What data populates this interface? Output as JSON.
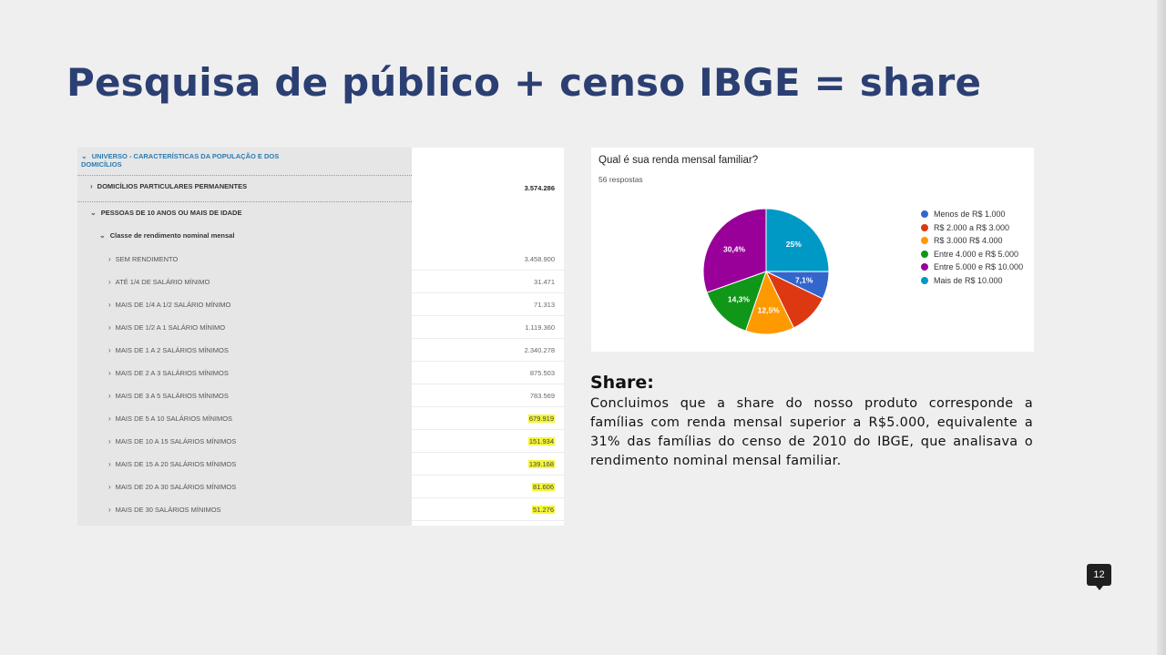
{
  "slide": {
    "title": "Pesquisa de público + censo IBGE = share",
    "page_number": "12"
  },
  "ibge": {
    "universe_label": "UNIVERSO - CARACTERÍSTICAS DA POPULAÇÃO E DOS DOMICÍLIOS",
    "domicilios_label": "DOMICÍLIOS PARTICULARES PERMANENTES",
    "domicilios_value": "3.574.286",
    "pessoas_label": "PESSOAS DE 10 ANOS OU MAIS DE IDADE",
    "classe_label": "Classe de rendimento nominal mensal",
    "rows": [
      {
        "label": "SEM RENDIMENTO",
        "value": "3.458.900",
        "highlight": false
      },
      {
        "label": "ATÉ 1/4 DE SALÁRIO MÍNIMO",
        "value": "31.471",
        "highlight": false
      },
      {
        "label": "MAIS DE 1/4 A 1/2 SALÁRIO MÍNIMO",
        "value": "71.313",
        "highlight": false
      },
      {
        "label": "MAIS DE 1/2 A 1 SALÁRIO MÍNIMO",
        "value": "1.119.360",
        "highlight": false
      },
      {
        "label": "MAIS DE 1 A 2 SALÁRIOS MÍNIMOS",
        "value": "2.340.278",
        "highlight": false
      },
      {
        "label": "MAIS DE 2 A 3 SALÁRIOS MÍNIMOS",
        "value": "875.503",
        "highlight": false
      },
      {
        "label": "MAIS DE 3 A 5 SALÁRIOS MÍNIMOS",
        "value": "783.569",
        "highlight": false
      },
      {
        "label": "MAIS DE 5 A 10 SALÁRIOS MÍNIMOS",
        "value": "679.919",
        "highlight": true
      },
      {
        "label": "MAIS DE 10 A 15 SALÁRIOS MÍNIMOS",
        "value": "151.934",
        "highlight": true
      },
      {
        "label": "MAIS DE 15 A 20 SALÁRIOS MÍNIMOS",
        "value": "139.168",
        "highlight": true
      },
      {
        "label": "MAIS DE 20 A 30 SALÁRIOS MÍNIMOS",
        "value": "81.606",
        "highlight": true
      },
      {
        "label": "MAIS DE 30 SALÁRIOS MÍNIMOS",
        "value": "51.276",
        "highlight": true
      }
    ]
  },
  "survey": {
    "question": "Qual é sua renda mensal familiar?",
    "responses": "56 respostas"
  },
  "chart_data": {
    "type": "pie",
    "title": "Qual é sua renda mensal familiar?",
    "legend_position": "right",
    "slices": [
      {
        "label": "Menos de R$ 1.000",
        "value": 7.1,
        "display": "7,1%",
        "color": "#3366cc"
      },
      {
        "label": "R$ 2.000 a R$ 3.000",
        "value": 10.6,
        "display": "",
        "color": "#dc3912"
      },
      {
        "label": "R$ 3.000 R$ 4.000",
        "value": 12.5,
        "display": "12,5%",
        "color": "#ff9900"
      },
      {
        "label": "Entre 4.000 e R$ 5.000",
        "value": 14.3,
        "display": "14,3%",
        "color": "#109618"
      },
      {
        "label": "Entre 5.000 e R$ 10.000",
        "value": 30.4,
        "display": "30,4%",
        "color": "#990099"
      },
      {
        "label": "Mais de R$ 10.000",
        "value": 25,
        "display": "25%",
        "color": "#0099c6"
      }
    ]
  },
  "share": {
    "title": "Share:",
    "body": "Concluimos que a share do nosso produto corresponde a famílias com renda mensal superior a R$5.000, equivalente a 31% das famílias do censo de 2010 do IBGE, que analisava o rendimento nominal mensal familiar."
  }
}
